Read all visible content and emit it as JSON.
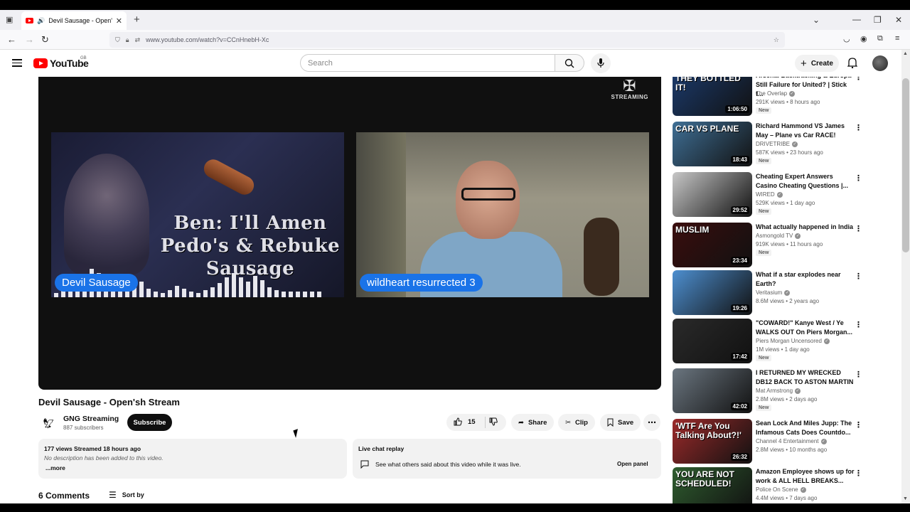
{
  "browser": {
    "tab_title": "Devil Sausage - Open'sh St",
    "url": "www.youtube.com/watch?v=CCnHnebH-Xc"
  },
  "header": {
    "logo_text": "YouTube",
    "country": "GB",
    "search_placeholder": "Search",
    "create_label": "Create"
  },
  "player": {
    "watermark": "STREAMING",
    "overlay_text": "Ben: I'll Amen Pedo's & Rebuke Sausage",
    "left_name": "Devil Sausage",
    "right_name": "wildheart resurrected 3"
  },
  "video": {
    "title": "Devil Sausage - Open'sh Stream",
    "channel_name": "GNG Streaming",
    "subscribers": "887 subscribers",
    "subscribe_label": "Subscribe",
    "likes": "15",
    "share_label": "Share",
    "clip_label": "Clip",
    "save_label": "Save"
  },
  "description": {
    "meta": "177 views  Streamed 18 hours ago",
    "empty": "No description has been added to this video.",
    "more": "...more"
  },
  "chat_replay": {
    "title": "Live chat replay",
    "desc": "See what others said about this video while it was live.",
    "open_panel": "Open panel"
  },
  "comments": {
    "count": "6 Comments",
    "sort_label": "Sort by"
  },
  "recommendations": [
    {
      "title": "Arsenal Backtracking & Europa Still Failure for United? | Stick t...",
      "channel": "The Overlap",
      "meta": "291K views • 8 hours ago",
      "new": "New",
      "duration": "1:06:50",
      "thumb_text": "THEY BOTTLED IT!",
      "color": "#1b3a6b"
    },
    {
      "title": "Richard Hammond VS James May – Plane vs Car RACE!",
      "channel": "DRIVETRIBE",
      "meta": "587K views • 23 hours ago",
      "new": "New",
      "duration": "18:43",
      "thumb_text": "CAR VS PLANE",
      "color": "#3f6f95"
    },
    {
      "title": "Cheating Expert Answers Casino Cheating Questions |...",
      "channel": "WIRED",
      "meta": "529K views • 1 day ago",
      "new": "New",
      "duration": "29:52",
      "thumb_text": "",
      "color": "#c7c7c7"
    },
    {
      "title": "What actually happened in India",
      "channel": "Asmongold TV",
      "meta": "919K views • 11 hours ago",
      "new": "New",
      "duration": "23:34",
      "thumb_text": "MUSLIM",
      "color": "#3a0d0d"
    },
    {
      "title": "What if a star explodes near Earth?",
      "channel": "Veritasium",
      "meta": "8.6M views • 2 years ago",
      "new": "",
      "duration": "19:26",
      "thumb_text": "",
      "color": "#4d8fd0"
    },
    {
      "title": "\"COWARD!\" Kanye West / Ye WALKS OUT On Piers Morgan...",
      "channel": "Piers Morgan Uncensored",
      "meta": "1M views • 1 day ago",
      "new": "New",
      "duration": "17:42",
      "thumb_text": "",
      "color": "#2a2a2a"
    },
    {
      "title": "I RETURNED MY WRECKED DB12 BACK TO ASTON MARTIN",
      "channel": "Mat Armstrong",
      "meta": "2.8M views • 2 days ago",
      "new": "New",
      "duration": "42:02",
      "thumb_text": "",
      "color": "#6b7680"
    },
    {
      "title": "Sean Lock And Miles Jupp: The Infamous Cats Does Countdo...",
      "channel": "Channel 4 Entertainment",
      "meta": "2.8M views • 10 months ago",
      "new": "",
      "duration": "26:32",
      "thumb_text": "'WTF Are You Talking About?!'",
      "color": "#9c2a2a"
    },
    {
      "title": "Amazon Employee shows up for work & ALL HELL BREAKS...",
      "channel": "Police On Scene",
      "meta": "4.4M views • 7 days ago",
      "new": "",
      "duration": "",
      "thumb_text": "YOU ARE NOT SCHEDULED!",
      "color": "#2f5d2f"
    }
  ]
}
